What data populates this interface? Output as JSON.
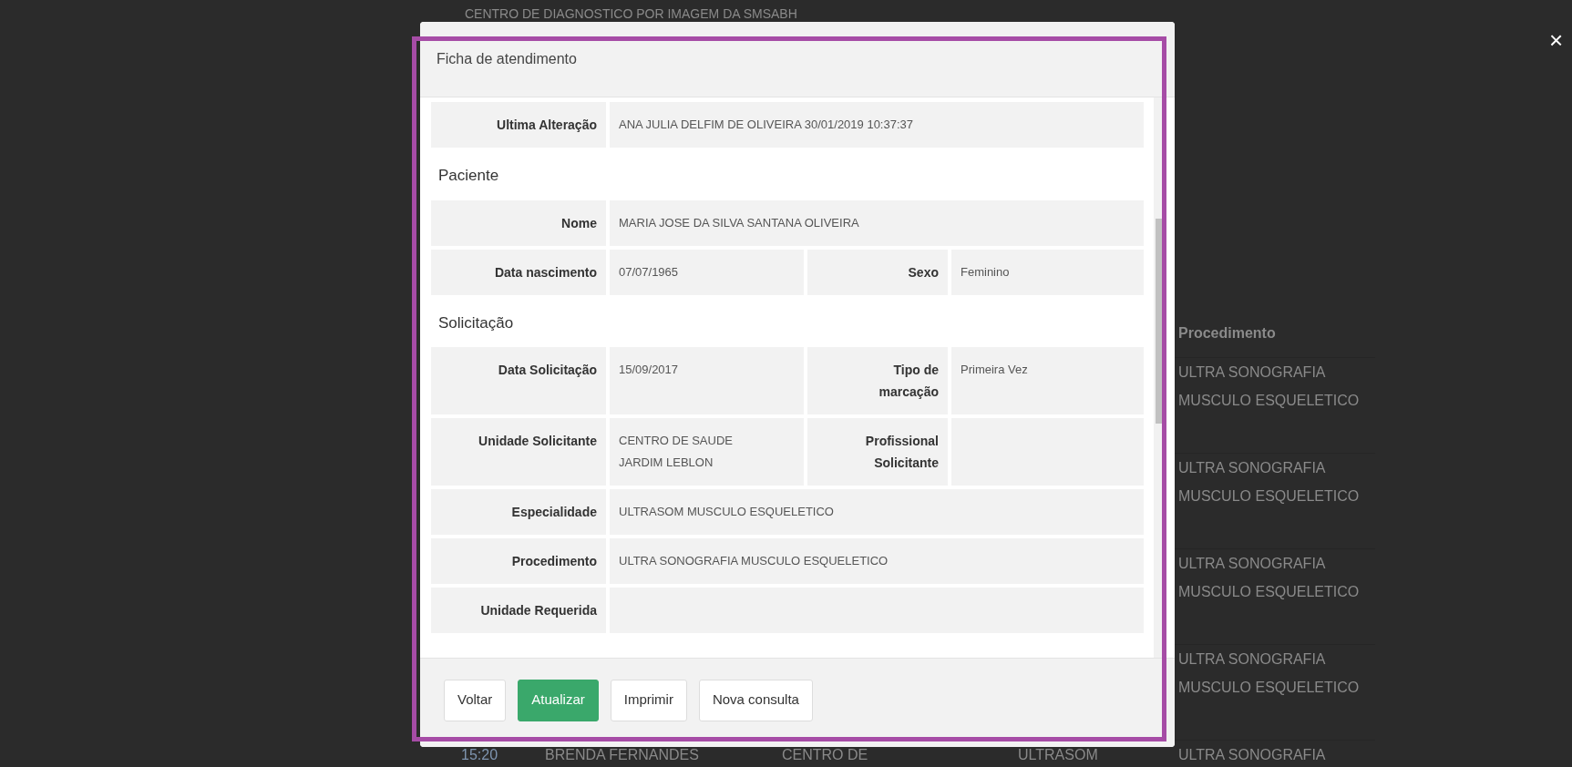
{
  "background": {
    "header": "CENTRO DE DIAGNOSTICO POR IMAGEM DA SMSABH",
    "table": {
      "procedimento_header": "Procedimento",
      "rows": [
        {
          "procedimento": "ULTRA SONOGRAFIA MUSCULO ESQUELETICO"
        },
        {
          "procedimento": "ULTRA SONOGRAFIA MUSCULO ESQUELETICO"
        },
        {
          "procedimento": "ULTRA SONOGRAFIA MUSCULO ESQUELETICO"
        },
        {
          "procedimento": "ULTRA SONOGRAFIA MUSCULO ESQUELETICO"
        },
        {
          "column_1": "15:20",
          "column_2": "BRENDA FERNANDES",
          "column_3": "CENTRO DE",
          "column_4": "ULTRASOM",
          "procedimento": "ULTRA SONOGRAFIA"
        }
      ]
    }
  },
  "close_button": "×",
  "modal": {
    "title": "Ficha de atendimento",
    "items": [
      {
        "kind": "field",
        "label": "Ultima Alteração",
        "value": "ANA JULIA DELFIM DE OLIVEIRA 30/01/2019 10:37:37"
      },
      {
        "kind": "heading",
        "text": "Paciente"
      },
      {
        "kind": "field",
        "label": "Nome",
        "value": "MARIA JOSE DA SILVA SANTANA OLIVEIRA"
      },
      {
        "kind": "pair",
        "fields": [
          {
            "label": "Data nascimento",
            "value": "07/07/1965"
          },
          {
            "label": "Sexo",
            "value": "Feminino"
          }
        ]
      },
      {
        "kind": "heading",
        "text": "Solicitação"
      },
      {
        "kind": "pair",
        "fields": [
          {
            "label": "Data Solicitação",
            "value": "15/09/2017"
          },
          {
            "label": "Tipo de marcação",
            "value": "Primeira Vez"
          }
        ]
      },
      {
        "kind": "pair",
        "fields": [
          {
            "label": "Unidade Solicitante",
            "value": "CENTRO DE SAUDE JARDIM LEBLON"
          },
          {
            "label": "Profissional Solicitante"
          }
        ]
      },
      {
        "kind": "field",
        "label": "Especialidade",
        "value": "ULTRASOM MUSCULO ESQUELETICO"
      },
      {
        "kind": "field",
        "label": "Procedimento",
        "value": "ULTRA SONOGRAFIA MUSCULO ESQUELETICO"
      },
      {
        "kind": "field",
        "label": "Unidade Requerida"
      }
    ],
    "buttons": [
      {
        "label": "Voltar",
        "kind": "default"
      },
      {
        "label": "Atualizar",
        "kind": "primary"
      },
      {
        "label": "Imprimir",
        "kind": "default"
      },
      {
        "label": "Nova consulta",
        "kind": "default"
      }
    ]
  }
}
